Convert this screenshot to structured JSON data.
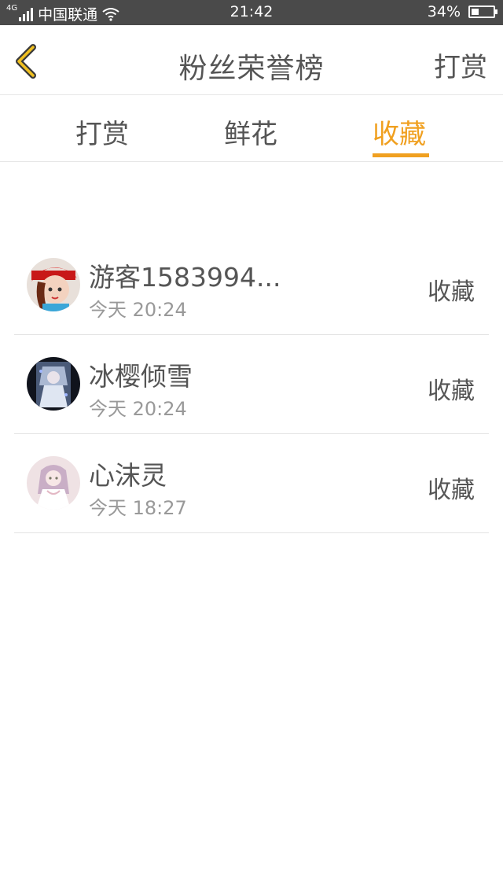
{
  "status_bar": {
    "network": "4G",
    "carrier": "中国联通",
    "time": "21:42",
    "battery_text": "34%",
    "battery_level": 0.34
  },
  "nav": {
    "title": "粉丝荣誉榜",
    "action": "打赏"
  },
  "tabs": [
    {
      "label": "打赏",
      "active": false
    },
    {
      "label": "鲜花",
      "active": false
    },
    {
      "label": "收藏",
      "active": true
    }
  ],
  "colors": {
    "accent": "#f0a020",
    "text": "#555555",
    "subtext": "#999999",
    "divider": "#e3e3e3",
    "status_bar_bg": "#4a4a4a"
  },
  "list": [
    {
      "name": "游客1583994...",
      "time": "今天 20:24",
      "tag": "收藏"
    },
    {
      "name": "冰樱倾雪",
      "time": "今天 20:24",
      "tag": "收藏"
    },
    {
      "name": "心沫灵",
      "time": "今天 18:27",
      "tag": "收藏"
    }
  ]
}
